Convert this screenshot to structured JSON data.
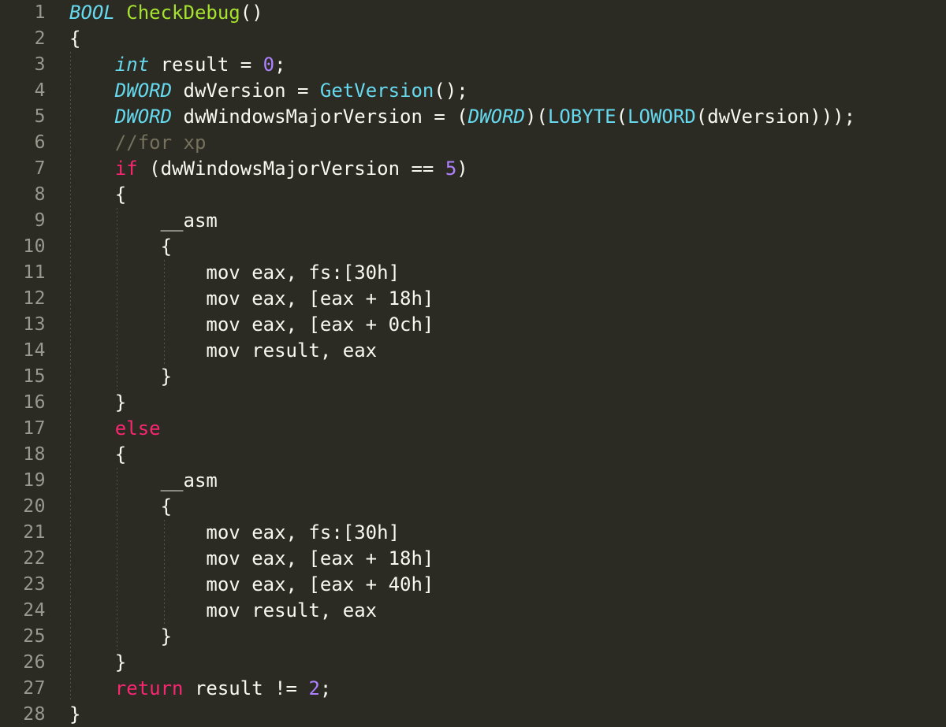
{
  "editor": {
    "language": "c",
    "theme": "monokai-dark",
    "background_color": "#2b2b23",
    "gutter_text_color": "#999990",
    "default_text_color": "#f8f8f2",
    "keyword_color": "#f92672",
    "type_color": "#66d9ef",
    "function_color": "#a6e22e",
    "number_color": "#ae81ff",
    "comment_color": "#75715e",
    "first_line_number": 1,
    "last_line_number": 28,
    "total_lines": 28,
    "indent_guide_columns": [
      0,
      4,
      8,
      12
    ]
  },
  "lines": [
    {
      "number": "1",
      "text": "BOOL CheckDebug()"
    },
    {
      "number": "2",
      "text": "{"
    },
    {
      "number": "3",
      "text": "    int result = 0;"
    },
    {
      "number": "4",
      "text": "    DWORD dwVersion = GetVersion();"
    },
    {
      "number": "5",
      "text": "    DWORD dwWindowsMajorVersion = (DWORD)(LOBYTE(LOWORD(dwVersion)));"
    },
    {
      "number": "6",
      "text": "    //for xp"
    },
    {
      "number": "7",
      "text": "    if (dwWindowsMajorVersion == 5)"
    },
    {
      "number": "8",
      "text": "    {"
    },
    {
      "number": "9",
      "text": "        __asm"
    },
    {
      "number": "10",
      "text": "        {"
    },
    {
      "number": "11",
      "text": "            mov eax, fs:[30h]"
    },
    {
      "number": "12",
      "text": "            mov eax, [eax + 18h]"
    },
    {
      "number": "13",
      "text": "            mov eax, [eax + 0ch]"
    },
    {
      "number": "14",
      "text": "            mov result, eax"
    },
    {
      "number": "15",
      "text": "        }"
    },
    {
      "number": "16",
      "text": "    }"
    },
    {
      "number": "17",
      "text": "    else"
    },
    {
      "number": "18",
      "text": "    {"
    },
    {
      "number": "19",
      "text": "        __asm"
    },
    {
      "number": "20",
      "text": "        {"
    },
    {
      "number": "21",
      "text": "            mov eax, fs:[30h]"
    },
    {
      "number": "22",
      "text": "            mov eax, [eax + 18h]"
    },
    {
      "number": "23",
      "text": "            mov eax, [eax + 40h]"
    },
    {
      "number": "24",
      "text": "            mov result, eax"
    },
    {
      "number": "25",
      "text": "        }"
    },
    {
      "number": "26",
      "text": "    }"
    },
    {
      "number": "27",
      "text": "    return result != 2;"
    },
    {
      "number": "28",
      "text": "}"
    }
  ],
  "tokens": [
    [
      {
        "t": "BOOL",
        "c": "type"
      },
      {
        "t": " ",
        "c": "plain"
      },
      {
        "t": "CheckDebug",
        "c": "fn"
      },
      {
        "t": "()",
        "c": "plain"
      }
    ],
    [
      {
        "t": "{",
        "c": "plain"
      }
    ],
    [
      {
        "t": "    ",
        "c": "plain"
      },
      {
        "t": "int",
        "c": "type"
      },
      {
        "t": " result = ",
        "c": "plain"
      },
      {
        "t": "0",
        "c": "num"
      },
      {
        "t": ";",
        "c": "plain"
      }
    ],
    [
      {
        "t": "    ",
        "c": "plain"
      },
      {
        "t": "DWORD",
        "c": "type"
      },
      {
        "t": " dwVersion = ",
        "c": "plain"
      },
      {
        "t": "GetVersion",
        "c": "call"
      },
      {
        "t": "();",
        "c": "plain"
      }
    ],
    [
      {
        "t": "    ",
        "c": "plain"
      },
      {
        "t": "DWORD",
        "c": "type"
      },
      {
        "t": " dwWindowsMajorVersion = (",
        "c": "plain"
      },
      {
        "t": "DWORD",
        "c": "type"
      },
      {
        "t": ")(",
        "c": "plain"
      },
      {
        "t": "LOBYTE",
        "c": "call"
      },
      {
        "t": "(",
        "c": "plain"
      },
      {
        "t": "LOWORD",
        "c": "call"
      },
      {
        "t": "(dwVersion)));",
        "c": "plain"
      }
    ],
    [
      {
        "t": "    ",
        "c": "plain"
      },
      {
        "t": "//for xp",
        "c": "cmt"
      }
    ],
    [
      {
        "t": "    ",
        "c": "plain"
      },
      {
        "t": "if",
        "c": "kw"
      },
      {
        "t": " (dwWindowsMajorVersion == ",
        "c": "plain"
      },
      {
        "t": "5",
        "c": "num"
      },
      {
        "t": ")",
        "c": "plain"
      }
    ],
    [
      {
        "t": "    {",
        "c": "plain"
      }
    ],
    [
      {
        "t": "        __asm",
        "c": "plain"
      }
    ],
    [
      {
        "t": "        {",
        "c": "plain"
      }
    ],
    [
      {
        "t": "            mov eax, fs:[30h]",
        "c": "plain"
      }
    ],
    [
      {
        "t": "            mov eax, [eax + 18h]",
        "c": "plain"
      }
    ],
    [
      {
        "t": "            mov eax, [eax + 0ch]",
        "c": "plain"
      }
    ],
    [
      {
        "t": "            mov result, eax",
        "c": "plain"
      }
    ],
    [
      {
        "t": "        }",
        "c": "plain"
      }
    ],
    [
      {
        "t": "    }",
        "c": "plain"
      }
    ],
    [
      {
        "t": "    ",
        "c": "plain"
      },
      {
        "t": "else",
        "c": "kw"
      }
    ],
    [
      {
        "t": "    {",
        "c": "plain"
      }
    ],
    [
      {
        "t": "        __asm",
        "c": "plain"
      }
    ],
    [
      {
        "t": "        {",
        "c": "plain"
      }
    ],
    [
      {
        "t": "            mov eax, fs:[30h]",
        "c": "plain"
      }
    ],
    [
      {
        "t": "            mov eax, [eax + 18h]",
        "c": "plain"
      }
    ],
    [
      {
        "t": "            mov eax, [eax + 40h]",
        "c": "plain"
      }
    ],
    [
      {
        "t": "            mov result, eax",
        "c": "plain"
      }
    ],
    [
      {
        "t": "        }",
        "c": "plain"
      }
    ],
    [
      {
        "t": "    }",
        "c": "plain"
      }
    ],
    [
      {
        "t": "    ",
        "c": "plain"
      },
      {
        "t": "return",
        "c": "kw"
      },
      {
        "t": " result != ",
        "c": "plain"
      },
      {
        "t": "2",
        "c": "num"
      },
      {
        "t": ";",
        "c": "plain"
      }
    ],
    [
      {
        "t": "}",
        "c": "plain"
      }
    ]
  ]
}
